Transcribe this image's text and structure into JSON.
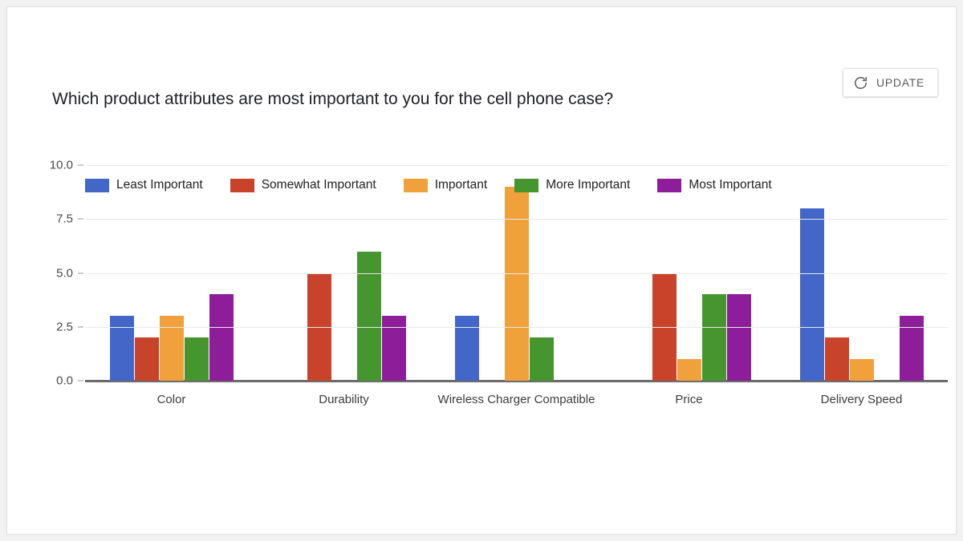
{
  "toolbar": {
    "update_label": "UPDATE",
    "refresh_icon": "refresh-icon"
  },
  "chart_data": {
    "type": "bar",
    "title": "Which product attributes are most important to you for the cell phone case?",
    "xlabel": "",
    "ylabel": "",
    "ylim": [
      0,
      10
    ],
    "yticks": [
      "0.0",
      "2.5",
      "5.0",
      "7.5",
      "10.0"
    ],
    "ytick_values": [
      0,
      2.5,
      5,
      7.5,
      10
    ],
    "grid": true,
    "legend_position": "top-left",
    "categories": [
      "Color",
      "Durability",
      "Wireless Charger Compatible",
      "Price",
      "Delivery Speed"
    ],
    "series": [
      {
        "name": "Least Important",
        "color": "#4366c9",
        "values": [
          3,
          0,
          3,
          0,
          8
        ]
      },
      {
        "name": "Somewhat Important",
        "color": "#c8432a",
        "values": [
          2,
          5,
          0,
          5,
          2
        ]
      },
      {
        "name": "Important",
        "color": "#f0a13c",
        "values": [
          3,
          0,
          9,
          1,
          1
        ]
      },
      {
        "name": "More Important",
        "color": "#46962f",
        "values": [
          2,
          6,
          2,
          4,
          0
        ]
      },
      {
        "name": "Most Important",
        "color": "#8e1d9a",
        "values": [
          4,
          3,
          0,
          4,
          3
        ]
      }
    ]
  }
}
